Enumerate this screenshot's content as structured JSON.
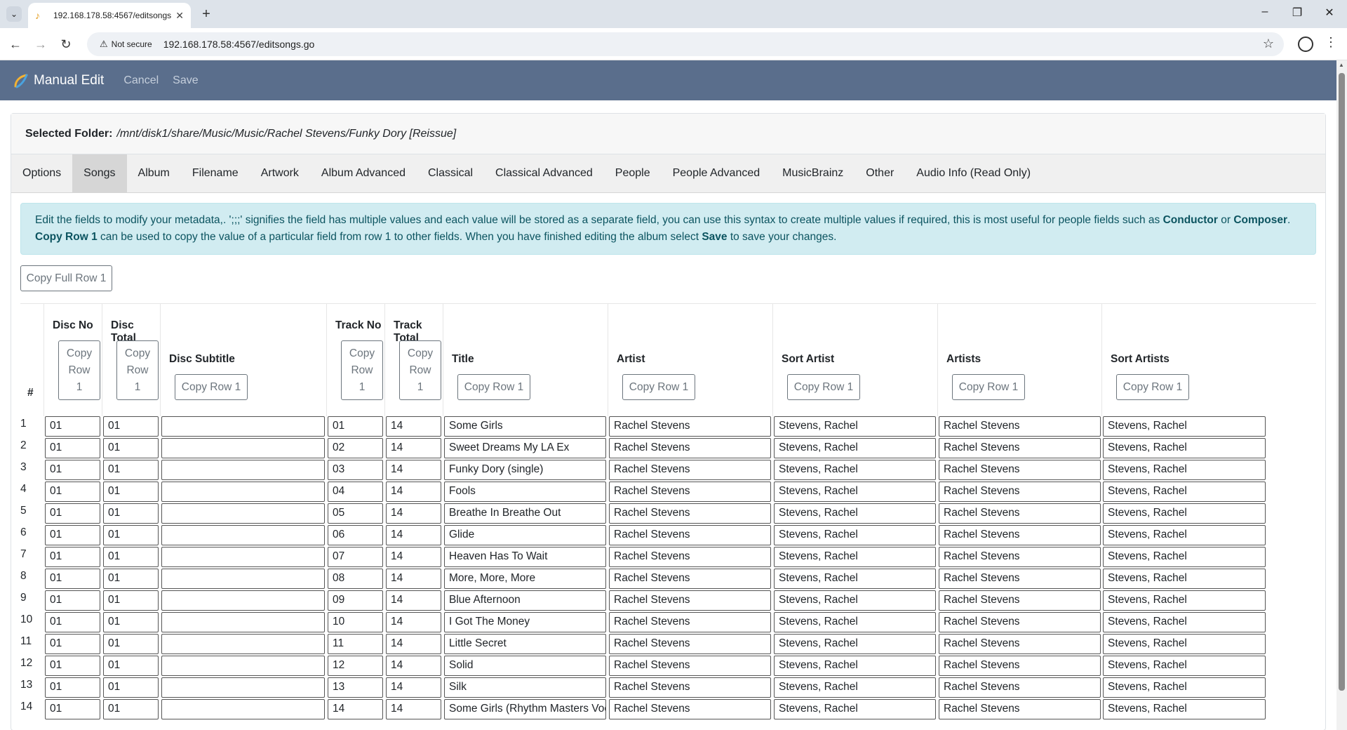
{
  "browser": {
    "tab_title": "192.168.178.58:4567/editsongs.go",
    "not_secure_label": "Not secure",
    "url": "192.168.178.58:4567/editsongs.go"
  },
  "app": {
    "brand": "Manual Edit",
    "nav": {
      "cancel": "Cancel",
      "save": "Save"
    }
  },
  "folder": {
    "label": "Selected Folder:",
    "path": "/mnt/disk1/share/Music/Music/Rachel Stevens/Funky Dory [Reissue]"
  },
  "tabs": [
    "Options",
    "Songs",
    "Album",
    "Filename",
    "Artwork",
    "Album Advanced",
    "Classical",
    "Classical Advanced",
    "People",
    "People Advanced",
    "MusicBrainz",
    "Other",
    "Audio Info (Read Only)"
  ],
  "active_tab": "Songs",
  "info": {
    "part1": "Edit the fields to modify your metadata,. ';;;' signifies the field has multiple values and each value will be stored as a separate field, you can use this syntax to create multiple values if required, this is most useful for people fields such as ",
    "conductor": "Conductor",
    "or": " or ",
    "composer": "Composer",
    "dot": ". ",
    "copy_row": "Copy Row 1",
    "part2": " can be used to copy the value of a particular field from row 1 to other fields. When you have finished editing the album select ",
    "save": "Save",
    "part3": " to save your changes."
  },
  "copy_full_row": "Copy Full Row 1",
  "columns": {
    "num": "#",
    "disc_no": "Disc No",
    "disc_total": "Disc Total",
    "disc_subtitle": "Disc Subtitle",
    "track_no": "Track No",
    "track_total": "Track Total",
    "title": "Title",
    "artist": "Artist",
    "sort_artist": "Sort Artist",
    "artists": "Artists",
    "sort_artists": "Sort Artists"
  },
  "copy_row": {
    "word1": "Copy",
    "word2": "Row",
    "word3": "1",
    "full": "Copy Row 1"
  },
  "rows": [
    {
      "n": "1",
      "disc_no": "01",
      "disc_total": "01",
      "disc_subtitle": "",
      "track_no": "01",
      "track_total": "14",
      "title": "Some Girls",
      "artist": "Rachel Stevens",
      "sort_artist": "Stevens, Rachel",
      "artists": "Rachel Stevens",
      "sort_artists": "Stevens, Rachel"
    },
    {
      "n": "2",
      "disc_no": "01",
      "disc_total": "01",
      "disc_subtitle": "",
      "track_no": "02",
      "track_total": "14",
      "title": "Sweet Dreams My LA Ex",
      "artist": "Rachel Stevens",
      "sort_artist": "Stevens, Rachel",
      "artists": "Rachel Stevens",
      "sort_artists": "Stevens, Rachel"
    },
    {
      "n": "3",
      "disc_no": "01",
      "disc_total": "01",
      "disc_subtitle": "",
      "track_no": "03",
      "track_total": "14",
      "title": "Funky Dory (single)",
      "artist": "Rachel Stevens",
      "sort_artist": "Stevens, Rachel",
      "artists": "Rachel Stevens",
      "sort_artists": "Stevens, Rachel"
    },
    {
      "n": "4",
      "disc_no": "01",
      "disc_total": "01",
      "disc_subtitle": "",
      "track_no": "04",
      "track_total": "14",
      "title": "Fools",
      "artist": "Rachel Stevens",
      "sort_artist": "Stevens, Rachel",
      "artists": "Rachel Stevens",
      "sort_artists": "Stevens, Rachel"
    },
    {
      "n": "5",
      "disc_no": "01",
      "disc_total": "01",
      "disc_subtitle": "",
      "track_no": "05",
      "track_total": "14",
      "title": "Breathe In Breathe Out",
      "artist": "Rachel Stevens",
      "sort_artist": "Stevens, Rachel",
      "artists": "Rachel Stevens",
      "sort_artists": "Stevens, Rachel"
    },
    {
      "n": "6",
      "disc_no": "01",
      "disc_total": "01",
      "disc_subtitle": "",
      "track_no": "06",
      "track_total": "14",
      "title": "Glide",
      "artist": "Rachel Stevens",
      "sort_artist": "Stevens, Rachel",
      "artists": "Rachel Stevens",
      "sort_artists": "Stevens, Rachel"
    },
    {
      "n": "7",
      "disc_no": "01",
      "disc_total": "01",
      "disc_subtitle": "",
      "track_no": "07",
      "track_total": "14",
      "title": "Heaven Has To Wait",
      "artist": "Rachel Stevens",
      "sort_artist": "Stevens, Rachel",
      "artists": "Rachel Stevens",
      "sort_artists": "Stevens, Rachel"
    },
    {
      "n": "8",
      "disc_no": "01",
      "disc_total": "01",
      "disc_subtitle": "",
      "track_no": "08",
      "track_total": "14",
      "title": "More, More, More",
      "artist": "Rachel Stevens",
      "sort_artist": "Stevens, Rachel",
      "artists": "Rachel Stevens",
      "sort_artists": "Stevens, Rachel"
    },
    {
      "n": "9",
      "disc_no": "01",
      "disc_total": "01",
      "disc_subtitle": "",
      "track_no": "09",
      "track_total": "14",
      "title": "Blue Afternoon",
      "artist": "Rachel Stevens",
      "sort_artist": "Stevens, Rachel",
      "artists": "Rachel Stevens",
      "sort_artists": "Stevens, Rachel"
    },
    {
      "n": "10",
      "disc_no": "01",
      "disc_total": "01",
      "disc_subtitle": "",
      "track_no": "10",
      "track_total": "14",
      "title": "I Got The Money",
      "artist": "Rachel Stevens",
      "sort_artist": "Stevens, Rachel",
      "artists": "Rachel Stevens",
      "sort_artists": "Stevens, Rachel"
    },
    {
      "n": "11",
      "disc_no": "01",
      "disc_total": "01",
      "disc_subtitle": "",
      "track_no": "11",
      "track_total": "14",
      "title": "Little Secret",
      "artist": "Rachel Stevens",
      "sort_artist": "Stevens, Rachel",
      "artists": "Rachel Stevens",
      "sort_artists": "Stevens, Rachel"
    },
    {
      "n": "12",
      "disc_no": "01",
      "disc_total": "01",
      "disc_subtitle": "",
      "track_no": "12",
      "track_total": "14",
      "title": "Solid",
      "artist": "Rachel Stevens",
      "sort_artist": "Stevens, Rachel",
      "artists": "Rachel Stevens",
      "sort_artists": "Stevens, Rachel"
    },
    {
      "n": "13",
      "disc_no": "01",
      "disc_total": "01",
      "disc_subtitle": "",
      "track_no": "13",
      "track_total": "14",
      "title": "Silk",
      "artist": "Rachel Stevens",
      "sort_artist": "Stevens, Rachel",
      "artists": "Rachel Stevens",
      "sort_artists": "Stevens, Rachel"
    },
    {
      "n": "14",
      "disc_no": "01",
      "disc_total": "01",
      "disc_subtitle": "",
      "track_no": "14",
      "track_total": "14",
      "title": "Some Girls (Rhythm Masters Vocal",
      "artist": "Rachel Stevens",
      "sort_artist": "Stevens, Rachel",
      "artists": "Rachel Stevens",
      "sort_artists": "Stevens, Rachel"
    }
  ]
}
